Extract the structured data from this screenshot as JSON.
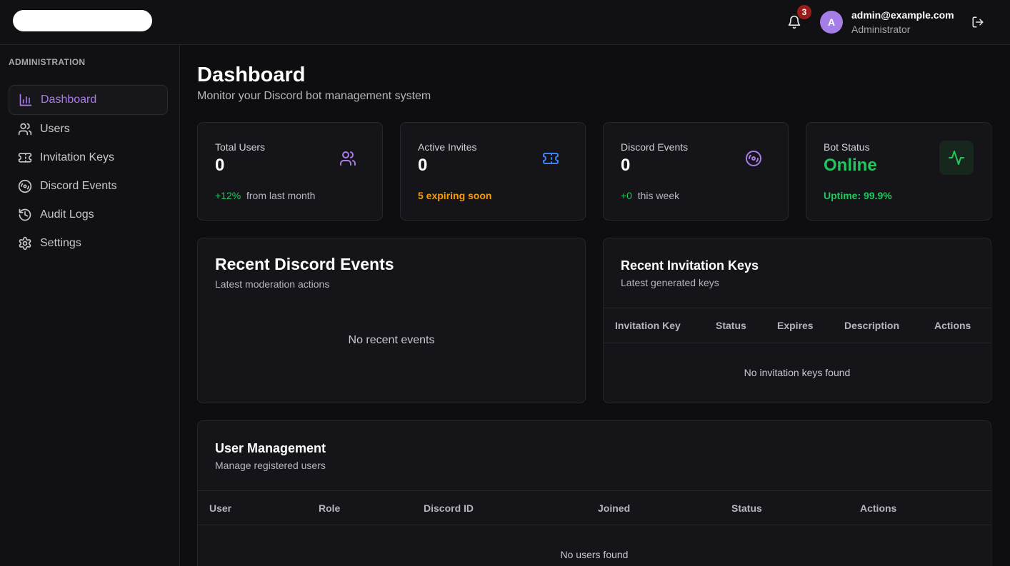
{
  "header": {
    "notification_count": "3",
    "avatar_initial": "A",
    "user_email": "admin@example.com",
    "user_role": "Administrator"
  },
  "sidebar": {
    "heading": "ADMINISTRATION",
    "items": [
      {
        "label": "Dashboard",
        "icon": "bar-chart-icon",
        "active": true
      },
      {
        "label": "Users",
        "icon": "users-icon"
      },
      {
        "label": "Invitation Keys",
        "icon": "ticket-icon"
      },
      {
        "label": "Discord Events",
        "icon": "disc-icon"
      },
      {
        "label": "Audit Logs",
        "icon": "history-icon"
      },
      {
        "label": "Settings",
        "icon": "gear-icon"
      }
    ]
  },
  "page": {
    "title": "Dashboard",
    "subtitle": "Monitor your Discord bot management system"
  },
  "stats": [
    {
      "label": "Total Users",
      "value": "0",
      "delta": "+12%",
      "foot": "from last month",
      "icon": "users-icon"
    },
    {
      "label": "Active Invites",
      "value": "0",
      "foot": "5 expiring soon",
      "icon": "ticket-icon"
    },
    {
      "label": "Discord Events",
      "value": "0",
      "delta": "+0",
      "foot": "this week",
      "icon": "disc-icon"
    },
    {
      "label": "Bot Status",
      "value": "Online",
      "foot": "Uptime: 99.9%",
      "icon": "activity-icon"
    }
  ],
  "recent_events": {
    "title": "Recent Discord Events",
    "subtitle": "Latest moderation actions",
    "empty": "No recent events"
  },
  "recent_keys": {
    "title": "Recent Invitation Keys",
    "subtitle": "Latest generated keys",
    "columns": [
      "Invitation Key",
      "Status",
      "Expires",
      "Description",
      "Actions"
    ],
    "empty": "No invitation keys found"
  },
  "user_management": {
    "title": "User Management",
    "subtitle": "Manage registered users",
    "columns": [
      "User",
      "Role",
      "Discord ID",
      "Joined",
      "Status",
      "Actions"
    ],
    "empty": "No users found"
  },
  "colors": {
    "accent": "#a97ce8",
    "success": "#22c55e",
    "warning": "#f59e0b",
    "ticket_blue": "#3b82f6",
    "badge_red": "#9b1c1c"
  }
}
